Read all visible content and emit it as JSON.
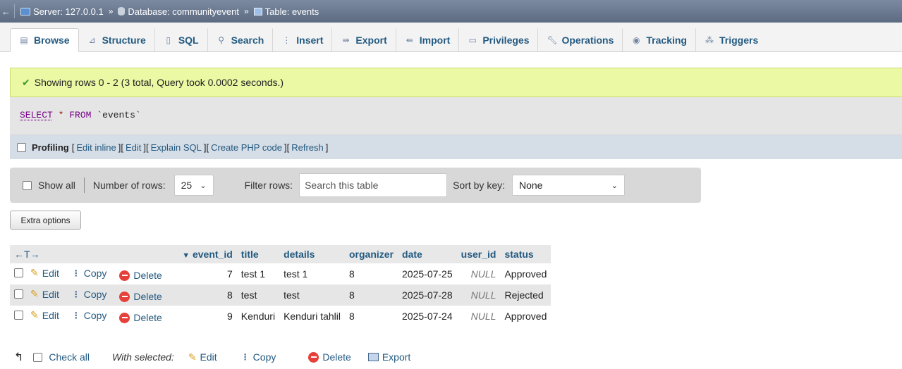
{
  "breadcrumb": {
    "back": "←",
    "server": "Server: 127.0.0.1",
    "database": "Database: communityevent",
    "table": "Table: events",
    "separator": "»"
  },
  "tabs": [
    {
      "label": "Browse",
      "icon": "browse-icon"
    },
    {
      "label": "Structure",
      "icon": "structure-icon"
    },
    {
      "label": "SQL",
      "icon": "sql-icon"
    },
    {
      "label": "Search",
      "icon": "search-icon"
    },
    {
      "label": "Insert",
      "icon": "insert-icon"
    },
    {
      "label": "Export",
      "icon": "export-icon"
    },
    {
      "label": "Import",
      "icon": "import-icon"
    },
    {
      "label": "Privileges",
      "icon": "privileges-icon"
    },
    {
      "label": "Operations",
      "icon": "operations-icon"
    },
    {
      "label": "Tracking",
      "icon": "tracking-icon"
    },
    {
      "label": "Triggers",
      "icon": "triggers-icon"
    }
  ],
  "success": {
    "message": "Showing rows 0 - 2 (3 total, Query took 0.0002 seconds.)"
  },
  "sql": {
    "select": "SELECT",
    "star": "*",
    "from": "FROM",
    "table": "`events`"
  },
  "profiling": {
    "label": "Profiling",
    "links": [
      "Edit inline",
      "Edit",
      "Explain SQL",
      "Create PHP code",
      "Refresh"
    ]
  },
  "nav": {
    "show_all": "Show all",
    "number_of_rows_label": "Number of rows:",
    "number_of_rows_value": "25",
    "filter_label": "Filter rows:",
    "filter_placeholder": "Search this table",
    "sort_label": "Sort by key:",
    "sort_value": "None"
  },
  "extra_options": "Extra options",
  "table": {
    "arrows": "←T→",
    "sort_arrow": "▼",
    "columns": [
      "event_id",
      "title",
      "details",
      "organizer",
      "date",
      "user_id",
      "status"
    ],
    "actions": {
      "edit": "Edit",
      "copy": "Copy",
      "delete": "Delete"
    },
    "rows": [
      {
        "event_id": "7",
        "title": "test 1",
        "details": "test 1",
        "organizer": "8",
        "date": "2025-07-25",
        "user_id": "NULL",
        "status": "Approved"
      },
      {
        "event_id": "8",
        "title": "test",
        "details": "test",
        "organizer": "8",
        "date": "2025-07-28",
        "user_id": "NULL",
        "status": "Rejected"
      },
      {
        "event_id": "9",
        "title": "Kenduri",
        "details": "Kenduri tahlil",
        "organizer": "8",
        "date": "2025-07-24",
        "user_id": "NULL",
        "status": "Approved"
      }
    ]
  },
  "bottom": {
    "check_all": "Check all",
    "with_selected": "With selected:",
    "edit": "Edit",
    "copy": "Copy",
    "delete": "Delete",
    "export": "Export"
  }
}
